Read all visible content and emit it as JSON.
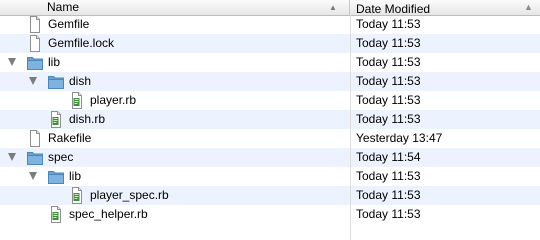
{
  "header": {
    "name_label": "Name",
    "date_label": "Date Modified"
  },
  "rows": [
    {
      "name": "Gemfile",
      "date": "Today 11:53",
      "kind": "file",
      "depth": 0
    },
    {
      "name": "Gemfile.lock",
      "date": "Today 11:53",
      "kind": "file",
      "depth": 0
    },
    {
      "name": "lib",
      "date": "Today 11:53",
      "kind": "folder",
      "depth": 0,
      "expanded": true
    },
    {
      "name": "dish",
      "date": "Today 11:53",
      "kind": "folder",
      "depth": 1,
      "expanded": true
    },
    {
      "name": "player.rb",
      "date": "Today 11:53",
      "kind": "ruby-file",
      "depth": 2
    },
    {
      "name": "dish.rb",
      "date": "Today 11:53",
      "kind": "ruby-file",
      "depth": 1
    },
    {
      "name": "Rakefile",
      "date": "Yesterday 13:47",
      "kind": "file",
      "depth": 0
    },
    {
      "name": "spec",
      "date": "Today 11:54",
      "kind": "folder",
      "depth": 0,
      "expanded": true
    },
    {
      "name": "lib",
      "date": "Today 11:53",
      "kind": "folder",
      "depth": 1,
      "expanded": true
    },
    {
      "name": "player_spec.rb",
      "date": "Today 11:53",
      "kind": "ruby-file",
      "depth": 2
    },
    {
      "name": "spec_helper.rb",
      "date": "Today 11:53",
      "kind": "ruby-file",
      "depth": 1
    }
  ],
  "colors": {
    "alt_row": "#edf3fe",
    "folder": "#7fb3df",
    "ruby_badge": "#3f8f3a"
  }
}
